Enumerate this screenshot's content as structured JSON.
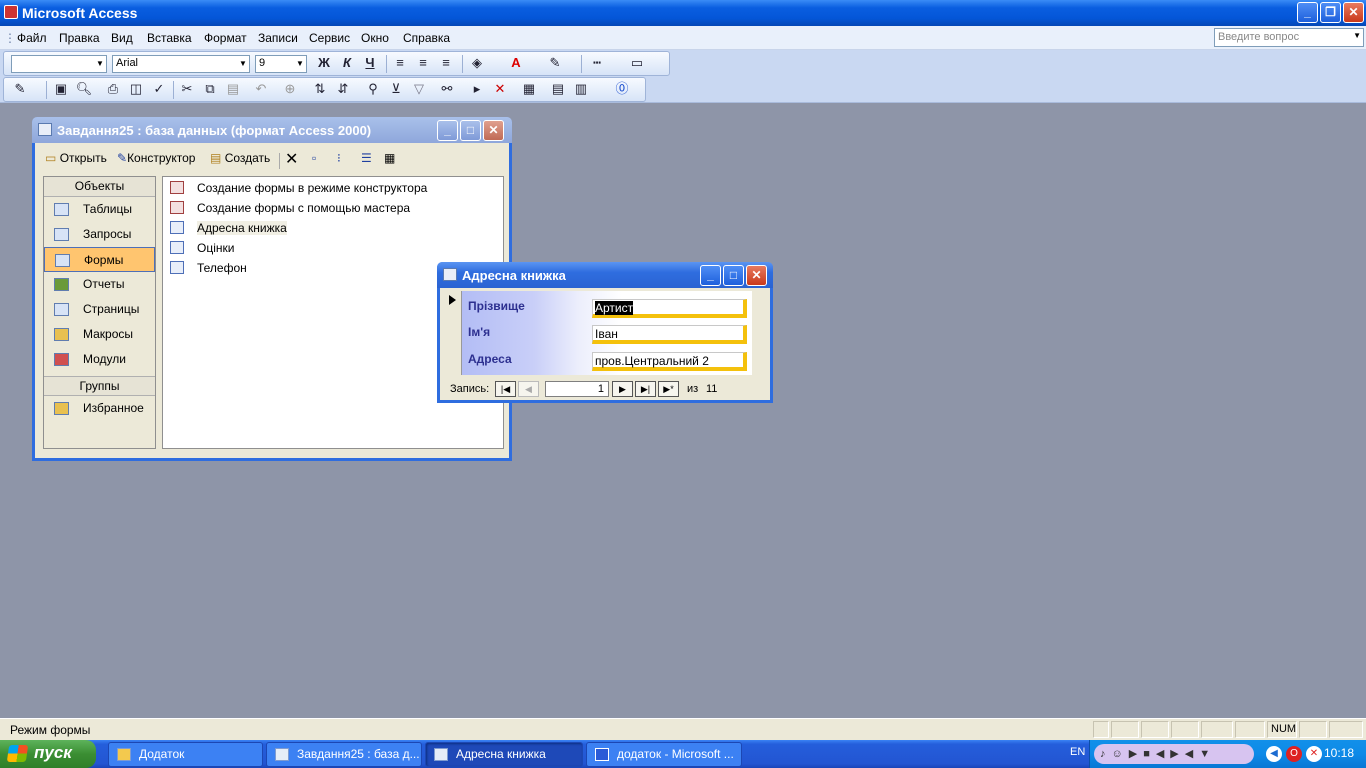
{
  "app": {
    "title": "Microsoft Access"
  },
  "menu": {
    "items": [
      "Файл",
      "Правка",
      "Вид",
      "Вставка",
      "Формат",
      "Записи",
      "Сервис",
      "Окно",
      "Справка"
    ],
    "help_placeholder": "Введите вопрос"
  },
  "format_toolbar": {
    "object_combo": "",
    "font": "Arial",
    "size": "9",
    "bold": "Ж",
    "italic": "К",
    "underline": "Ч"
  },
  "db_window": {
    "title": "Завдання25 : база данных (формат Access 2000)",
    "toolbar": {
      "open": "Открыть",
      "design": "Конструктор",
      "create": "Создать"
    },
    "objects_header": "Объекты",
    "objects": [
      {
        "label": "Таблицы",
        "icon": "table-icon"
      },
      {
        "label": "Запросы",
        "icon": "query-icon"
      },
      {
        "label": "Формы",
        "icon": "form-icon",
        "selected": true
      },
      {
        "label": "Отчеты",
        "icon": "report-icon"
      },
      {
        "label": "Страницы",
        "icon": "page-icon"
      },
      {
        "label": "Макросы",
        "icon": "macro-icon"
      },
      {
        "label": "Модули",
        "icon": "module-icon"
      }
    ],
    "groups_header": "Группы",
    "groups": [
      {
        "label": "Избранное",
        "icon": "favorites-icon"
      }
    ],
    "items": [
      {
        "label": "Создание формы в режиме конструктора",
        "icon": "design-wizard-icon"
      },
      {
        "label": "Создание формы с помощью мастера",
        "icon": "form-wizard-icon"
      },
      {
        "label": "Адресна книжка",
        "icon": "form-icon"
      },
      {
        "label": "Оцінки",
        "icon": "form-icon"
      },
      {
        "label": "Телефон",
        "icon": "form-icon"
      }
    ]
  },
  "form_window": {
    "title": "Адресна книжка",
    "fields": [
      {
        "label": "Прізвище",
        "value": "Артист"
      },
      {
        "label": "Ім'я",
        "value": "Іван"
      },
      {
        "label": "Адреса",
        "value": "пров.Центральний 2"
      }
    ],
    "nav": {
      "record_label": "Запись:",
      "current": "1",
      "of_label": "из",
      "total": "11"
    }
  },
  "status": {
    "text": "Режим формы",
    "num": "NUM"
  },
  "taskbar": {
    "start": "пуск",
    "tasks": [
      {
        "label": "Додаток",
        "active": false
      },
      {
        "label": "Завдання25 : база д...",
        "active": false
      },
      {
        "label": "Адресна книжка",
        "active": true
      },
      {
        "label": "додаток - Microsoft ...",
        "active": false
      }
    ],
    "lang": "EN",
    "clock": "10:18"
  },
  "colors": {
    "titlebar": "#0a5ee0",
    "taskbar": "#245edb",
    "selected_object": "#ffc56f",
    "form_field_shadow": "#f4c10c",
    "label_text": "#2d3090"
  }
}
